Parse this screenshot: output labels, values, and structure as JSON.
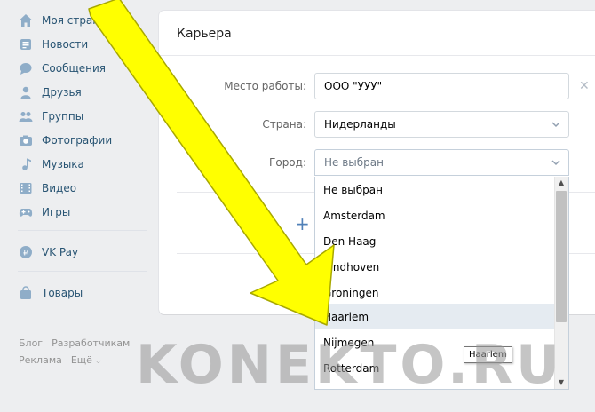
{
  "sidebar": {
    "items": [
      {
        "label": "Моя страница",
        "icon": "home-icon"
      },
      {
        "label": "Новости",
        "icon": "news-icon"
      },
      {
        "label": "Сообщения",
        "icon": "messages-icon"
      },
      {
        "label": "Друзья",
        "icon": "friends-icon"
      },
      {
        "label": "Группы",
        "icon": "groups-icon"
      },
      {
        "label": "Фотографии",
        "icon": "camera-icon"
      },
      {
        "label": "Музыка",
        "icon": "music-icon"
      },
      {
        "label": "Видео",
        "icon": "video-icon"
      },
      {
        "label": "Игры",
        "icon": "gamepad-icon"
      },
      {
        "label": "VK Pay",
        "icon": "ruble-icon"
      },
      {
        "label": "Товары",
        "icon": "bag-icon"
      }
    ],
    "footer": {
      "blog": "Блог",
      "developers": "Разработчикам",
      "ads": "Реклама",
      "more": "Ещё"
    }
  },
  "career": {
    "title": "Карьера",
    "workplace_label": "Место работы:",
    "workplace_value": "ООО \"УУУ\"",
    "clear": "✕",
    "country_label": "Страна:",
    "country_value": "Нидерланды",
    "city_label": "Город:",
    "city_value": "Не выбран",
    "add": "+"
  },
  "city_dropdown": {
    "options": [
      "Не выбран",
      "Amsterdam",
      "Den Haag",
      "Eindhoven",
      "Groningen",
      "Haarlem",
      "Nijmegen",
      "Rotterdam"
    ],
    "highlighted": "Haarlem",
    "tooltip": "Haarlem"
  },
  "watermark": "KONEKTO.RU",
  "colors": {
    "link": "#285473",
    "accent": "#5181b8",
    "arrow": "#ffff00"
  }
}
